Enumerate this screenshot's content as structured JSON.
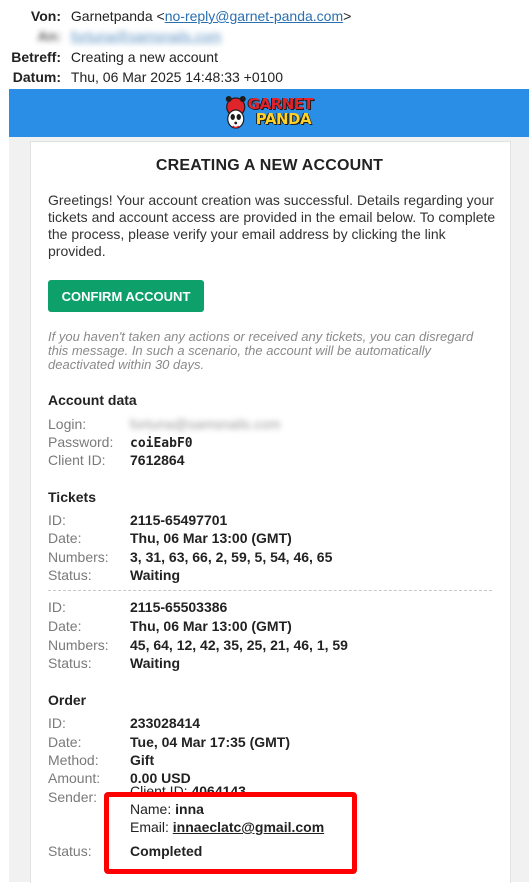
{
  "email_headers": {
    "from_key": "Von:",
    "from_name": "Garnetpanda",
    "from_email_open": "<",
    "from_email": "no-reply@garnet-panda.com",
    "from_email_close": ">",
    "to_key": "An:",
    "to_value": "fortuna@samsnails.com",
    "subject_key": "Betreff:",
    "subject_value": "Creating a new account",
    "date_key": "Datum:",
    "date_value": "Thu, 06 Mar 2025 14:48:33 +0100"
  },
  "brand": {
    "logo_line1": "GARNET",
    "logo_line2": "PANDA",
    "banner_color": "#2a8de6",
    "accent_green": "#0ea06b",
    "highlight_red": "#ff0000"
  },
  "email_body": {
    "title": "CREATING A NEW ACCOUNT",
    "intro": "Greetings! Your account creation was successful. Details regarding your tickets and account access are provided in the email below. To complete the process, please verify your email address by clicking the link provided.",
    "confirm_button": "CONFIRM ACCOUNT",
    "note": "If you haven't taken any actions or received any tickets, you can disregard this message. In such a scenario, the account will be automatically deactivated within 30 days."
  },
  "account": {
    "section_title": "Account data",
    "login_label": "Login:",
    "login_value": "fortuna@samsnails.com",
    "password_label": "Password:",
    "password_value": "coiEabF0",
    "client_id_label": "Client ID:",
    "client_id_value": "7612864"
  },
  "tickets": {
    "section_title": "Tickets",
    "items": [
      {
        "id_label": "ID:",
        "id": "2115-65497701",
        "date_label": "Date:",
        "date": "Thu, 06 Mar 13:00 (GMT)",
        "numbers_label": "Numbers:",
        "numbers": "3, 31, 63, 66, 2, 59, 5, 54, 46, 65",
        "status_label": "Status:",
        "status": "Waiting"
      },
      {
        "id_label": "ID:",
        "id": "2115-65503386",
        "date_label": "Date:",
        "date": "Thu, 06 Mar 13:00 (GMT)",
        "numbers_label": "Numbers:",
        "numbers": "45, 64, 12, 42, 35, 25, 21, 46, 1, 59",
        "status_label": "Status:",
        "status": "Waiting"
      }
    ]
  },
  "order": {
    "section_title": "Order",
    "id_label": "ID:",
    "id": "233028414",
    "date_label": "Date:",
    "date": "Tue, 04 Mar 17:35 (GMT)",
    "method_label": "Method:",
    "method": "Gift",
    "amount_label": "Amount:",
    "amount": "0.00 USD",
    "sender_label": "Sender:",
    "sender_client_id_label": "Client ID:",
    "sender_client_id": "4064143",
    "sender_name_label": "Name:",
    "sender_name": "inna",
    "sender_email_label": "Email:",
    "sender_email": "innaeclatc@gmail.com",
    "status_label": "Status:",
    "status": "Completed"
  }
}
